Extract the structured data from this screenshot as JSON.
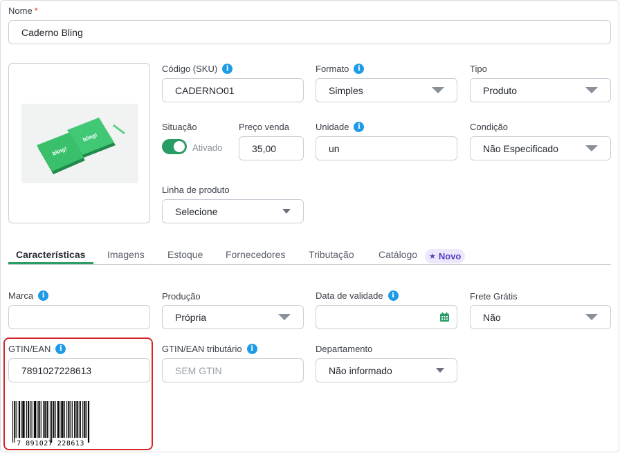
{
  "colors": {
    "accent": "#2a9d67",
    "info": "#1e9be6",
    "highlight": "#d6242b",
    "badge_text": "#5c3fc2"
  },
  "nome": {
    "label": "Nome",
    "required_mark": "*",
    "value": "Caderno Bling"
  },
  "image": {
    "alt_icon": "product-photo-notebooks"
  },
  "sku": {
    "label": "Código (SKU)",
    "value": "CADERNO01"
  },
  "formato": {
    "label": "Formato",
    "value": "Simples"
  },
  "tipo": {
    "label": "Tipo",
    "value": "Produto"
  },
  "situacao": {
    "label": "Situação",
    "status": "Ativado",
    "on": true
  },
  "preco": {
    "label": "Preço venda",
    "value": "35,00"
  },
  "unidade": {
    "label": "Unidade",
    "value": "un"
  },
  "condicao": {
    "label": "Condição",
    "value": "Não Especificado"
  },
  "linha": {
    "label": "Linha de produto",
    "value": "Selecione"
  },
  "tabs": {
    "items": [
      "Características",
      "Imagens",
      "Estoque",
      "Fornecedores",
      "Tributação",
      "Catálogo"
    ],
    "badge": "Novo",
    "active_index": 0
  },
  "marca": {
    "label": "Marca",
    "value": ""
  },
  "producao": {
    "label": "Produção",
    "value": "Própria"
  },
  "validade": {
    "label": "Data de validade",
    "value": ""
  },
  "frete": {
    "label": "Frete Grátis",
    "value": "Não"
  },
  "gtin": {
    "label": "GTIN/EAN",
    "value": "7891027228613",
    "barcode_text": "7 891027 228613"
  },
  "gtin_trib": {
    "label": "GTIN/EAN tributário",
    "placeholder": "SEM GTIN"
  },
  "departamento": {
    "label": "Departamento",
    "value": "Não informado"
  }
}
